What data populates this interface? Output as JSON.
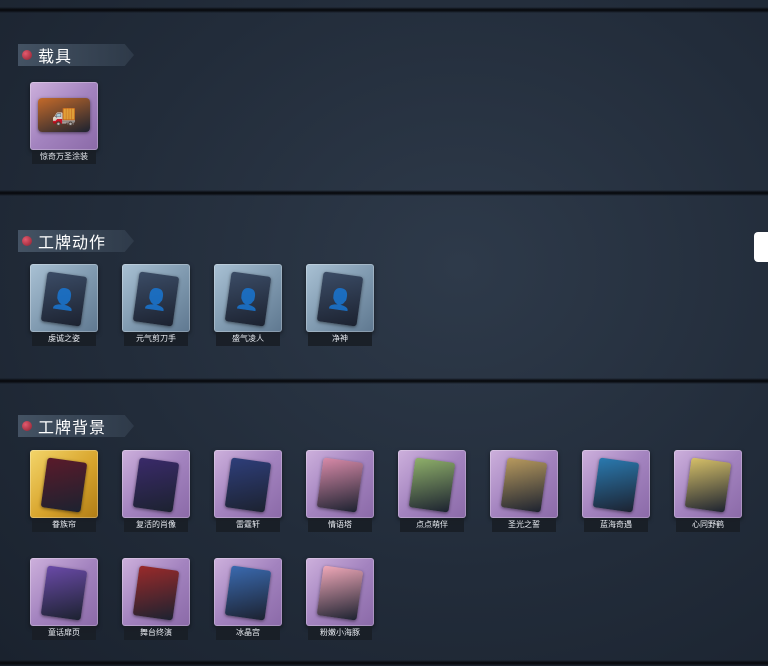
{
  "sections": {
    "vehicle": {
      "title": "载具",
      "items": [
        {
          "label": "惊奇万圣涂装",
          "rarity": "purple",
          "icon": "halloween-truck-icon",
          "glyph": "🚚",
          "art_color": "#c46a2a"
        }
      ]
    },
    "action": {
      "title": "工牌动作",
      "items": [
        {
          "label": "虔诚之姿",
          "rarity": "blue",
          "icon": "pose-silhouette-icon",
          "glyph": "👤",
          "art_color": "#3b4c66"
        },
        {
          "label": "元气剪刀手",
          "rarity": "blue",
          "icon": "pose-silhouette-icon",
          "glyph": "👤",
          "art_color": "#3b4c66"
        },
        {
          "label": "盛气凌人",
          "rarity": "blue",
          "icon": "pose-silhouette-icon",
          "glyph": "👤",
          "art_color": "#3b4c66"
        },
        {
          "label": "净神",
          "rarity": "blue",
          "icon": "pose-silhouette-icon",
          "glyph": "👤",
          "art_color": "#3b4c66"
        }
      ]
    },
    "background": {
      "title": "工牌背景",
      "items": [
        {
          "label": "眷族帘",
          "rarity": "gold",
          "icon": "curtain-card-icon",
          "glyph": "",
          "art_color": "#5a1a2a"
        },
        {
          "label": "复活的肖像",
          "rarity": "purple",
          "icon": "portrait-card-icon",
          "glyph": "",
          "art_color": "#3a2a6a"
        },
        {
          "label": "雷霆轩",
          "rarity": "purple",
          "icon": "thunder-card-icon",
          "glyph": "",
          "art_color": "#2e3e7a"
        },
        {
          "label": "情语塔",
          "rarity": "purple",
          "icon": "tower-card-icon",
          "glyph": "",
          "art_color": "#d88aa8"
        },
        {
          "label": "点点萌伴",
          "rarity": "purple",
          "icon": "meadow-card-icon",
          "glyph": "",
          "art_color": "#8fb06a"
        },
        {
          "label": "圣光之誓",
          "rarity": "purple",
          "icon": "holy-light-card-icon",
          "glyph": "",
          "art_color": "#b89a5e"
        },
        {
          "label": "蓝海奇遇",
          "rarity": "purple",
          "icon": "ocean-card-icon",
          "glyph": "",
          "art_color": "#2a7ab0"
        },
        {
          "label": "心同野鹤",
          "rarity": "purple",
          "icon": "crane-card-icon",
          "glyph": "",
          "art_color": "#d6c068"
        },
        {
          "label": "童话扉页",
          "rarity": "purple",
          "icon": "fairytale-card-icon",
          "glyph": "",
          "art_color": "#6a4aa8"
        },
        {
          "label": "舞台终演",
          "rarity": "purple",
          "icon": "stage-card-icon",
          "glyph": "",
          "art_color": "#9a2a2a"
        },
        {
          "label": "冰晶宫",
          "rarity": "purple",
          "icon": "ice-palace-card-icon",
          "glyph": "",
          "art_color": "#3a6ab0"
        },
        {
          "label": "粉嫩小海豚",
          "rarity": "purple",
          "icon": "pink-dolphin-card-icon",
          "glyph": "",
          "art_color": "#f0a8b8"
        }
      ]
    }
  }
}
